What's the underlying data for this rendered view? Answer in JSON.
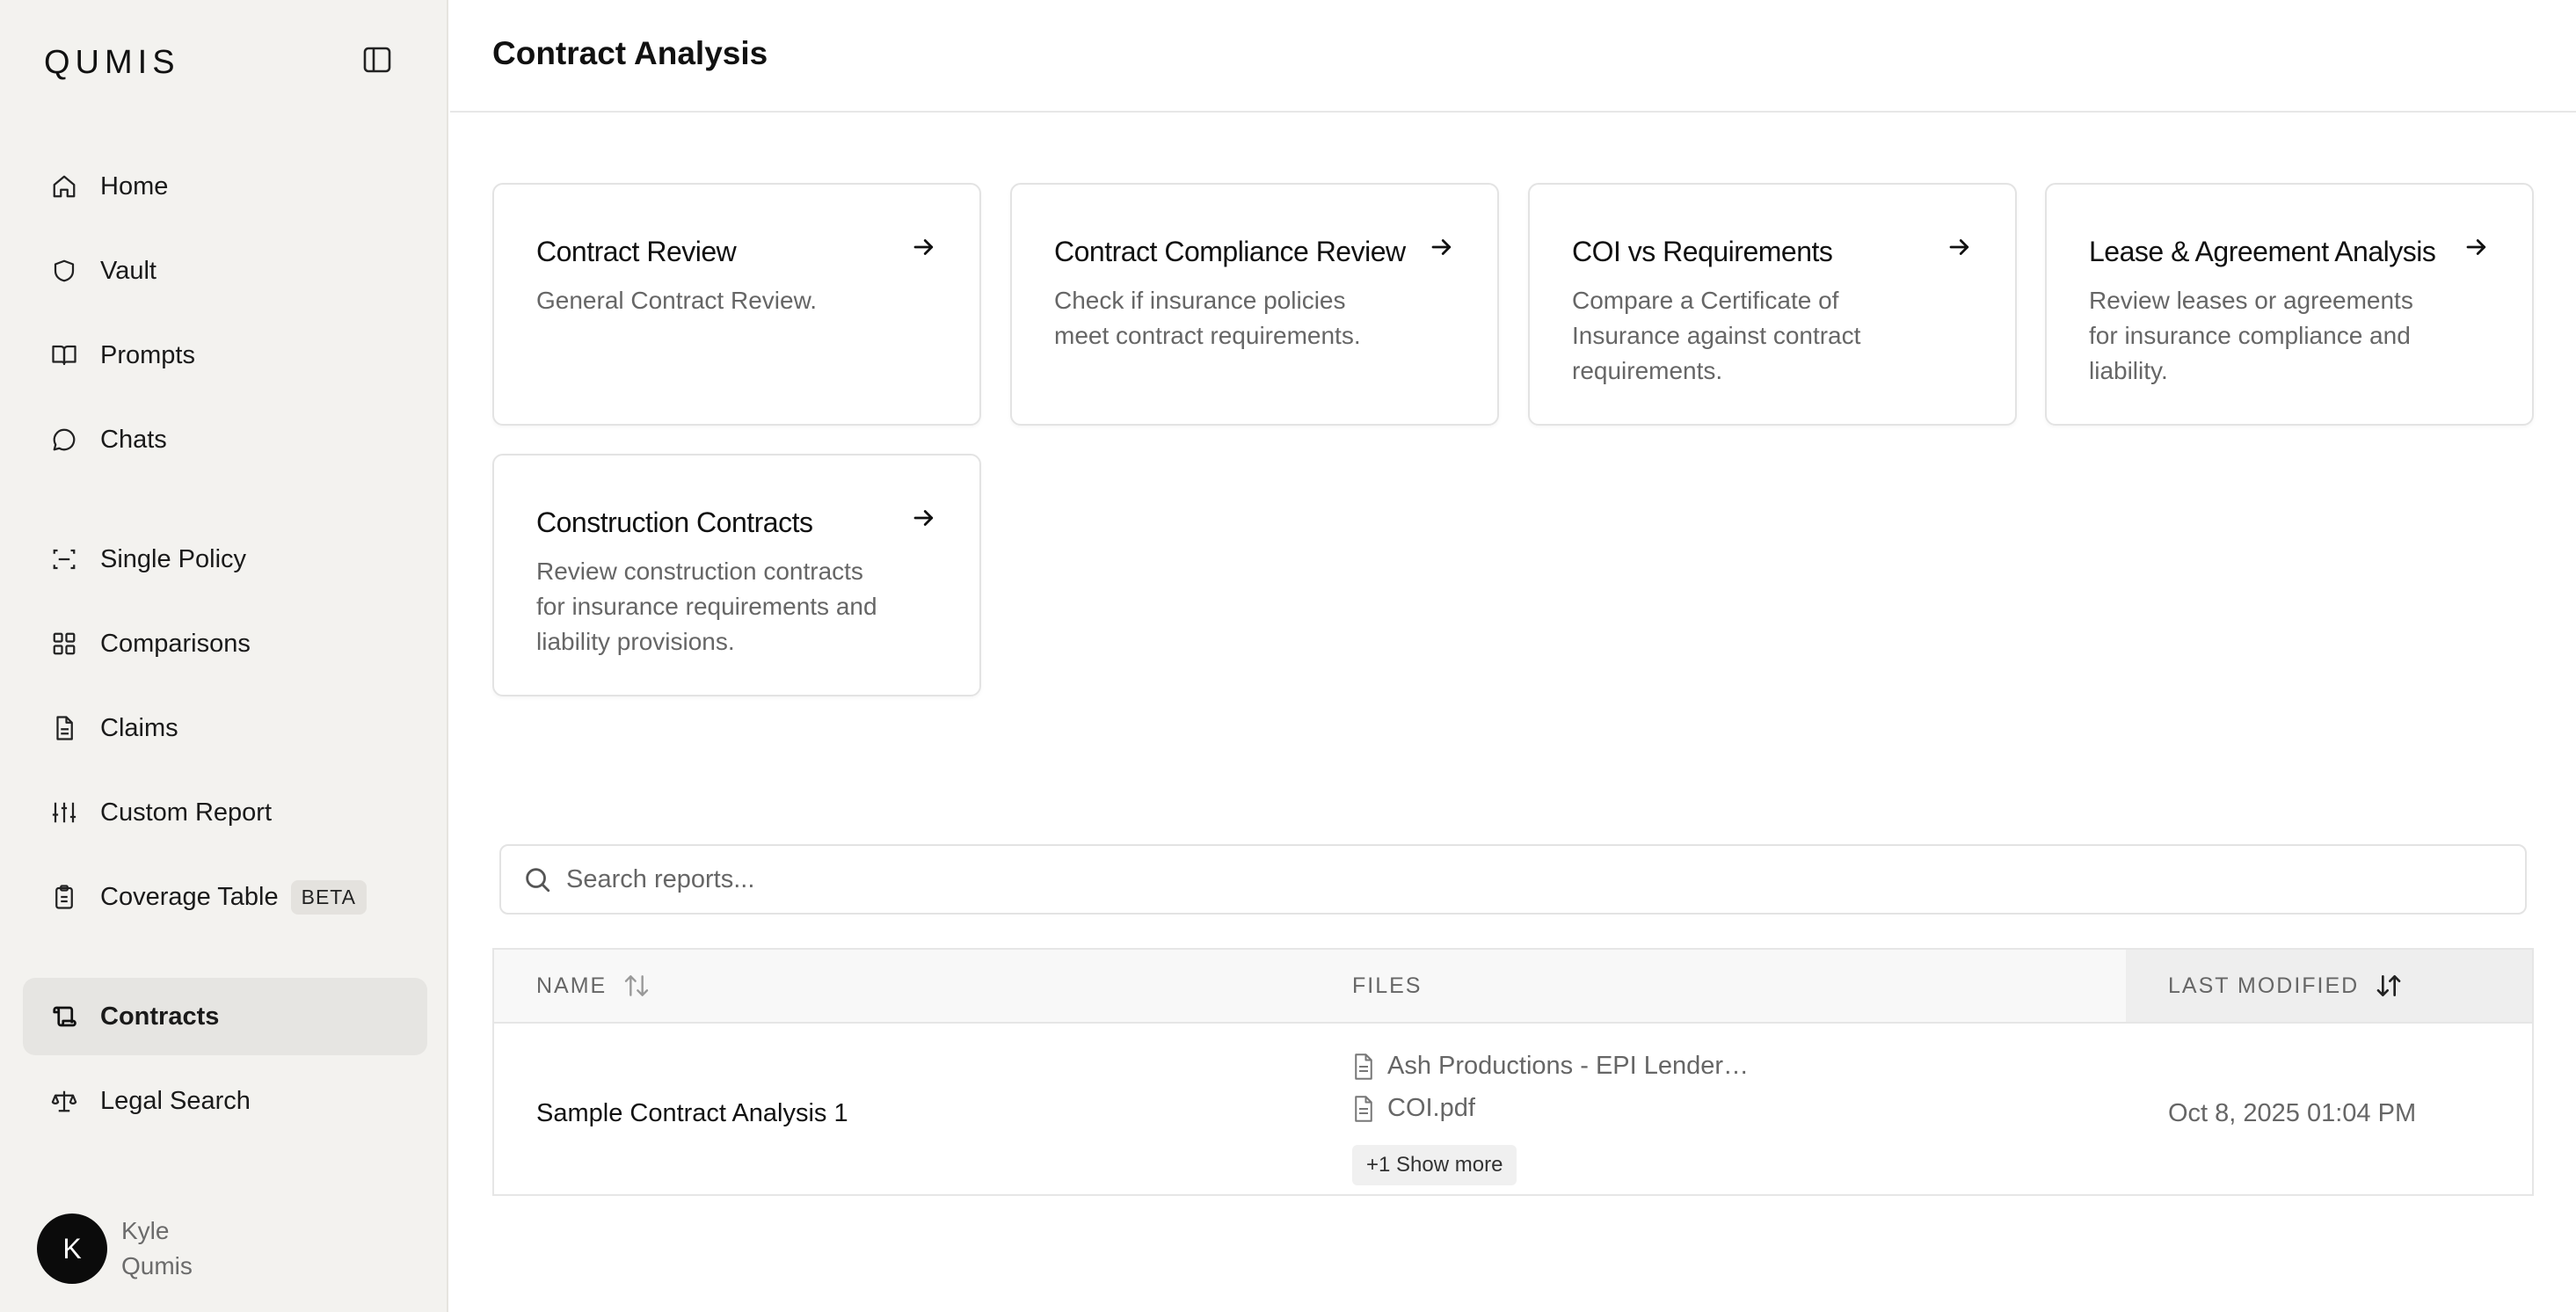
{
  "app": {
    "logo": "QUMIS"
  },
  "sidebar": {
    "items": [
      {
        "label": "Home",
        "icon": "home-icon"
      },
      {
        "label": "Vault",
        "icon": "shield-icon"
      },
      {
        "label": "Prompts",
        "icon": "book-icon"
      },
      {
        "label": "Chats",
        "icon": "chat-bubble-icon"
      },
      {
        "label": "Single Policy",
        "icon": "scan-icon"
      },
      {
        "label": "Comparisons",
        "icon": "grid-icon"
      },
      {
        "label": "Claims",
        "icon": "document-icon"
      },
      {
        "label": "Custom Report",
        "icon": "sliders-icon"
      },
      {
        "label": "Coverage Table",
        "icon": "clipboard-icon",
        "badge": "BETA"
      },
      {
        "label": "Contracts",
        "icon": "scroll-icon",
        "active": true
      },
      {
        "label": "Legal Search",
        "icon": "scale-icon"
      }
    ],
    "user": {
      "initial": "K",
      "first_name": "Kyle",
      "last_name": "Qumis"
    }
  },
  "header": {
    "title": "Contract Analysis"
  },
  "cards": [
    {
      "title": "Contract Review",
      "description": "General Contract Review."
    },
    {
      "title": "Contract Compliance Review",
      "description": "Check if insurance policies meet contract requirements."
    },
    {
      "title": "COI vs Requirements",
      "description": "Compare a Certificate of Insurance against contract requirements."
    },
    {
      "title": "Lease & Agreement Analysis",
      "description": "Review leases or agreements for insurance compliance and liability."
    },
    {
      "title": "Construction Contracts",
      "description": "Review construction contracts for insurance requirements and liability provisions."
    }
  ],
  "search": {
    "placeholder": "Search reports..."
  },
  "table": {
    "columns": {
      "name": "NAME",
      "files": "FILES",
      "last_modified": "LAST MODIFIED"
    },
    "rows": [
      {
        "name": "Sample Contract Analysis 1",
        "files": [
          "Ash Productions - EPI Lender…",
          "COI.pdf"
        ],
        "show_more": "+1 Show more",
        "last_modified": "Oct 8, 2025 01:04 PM"
      }
    ]
  },
  "colors": {
    "sidebar_bg": "#f3f2ef",
    "active_item_bg": "#e6e5e2",
    "avatar_bg": "#0b0b0b"
  }
}
